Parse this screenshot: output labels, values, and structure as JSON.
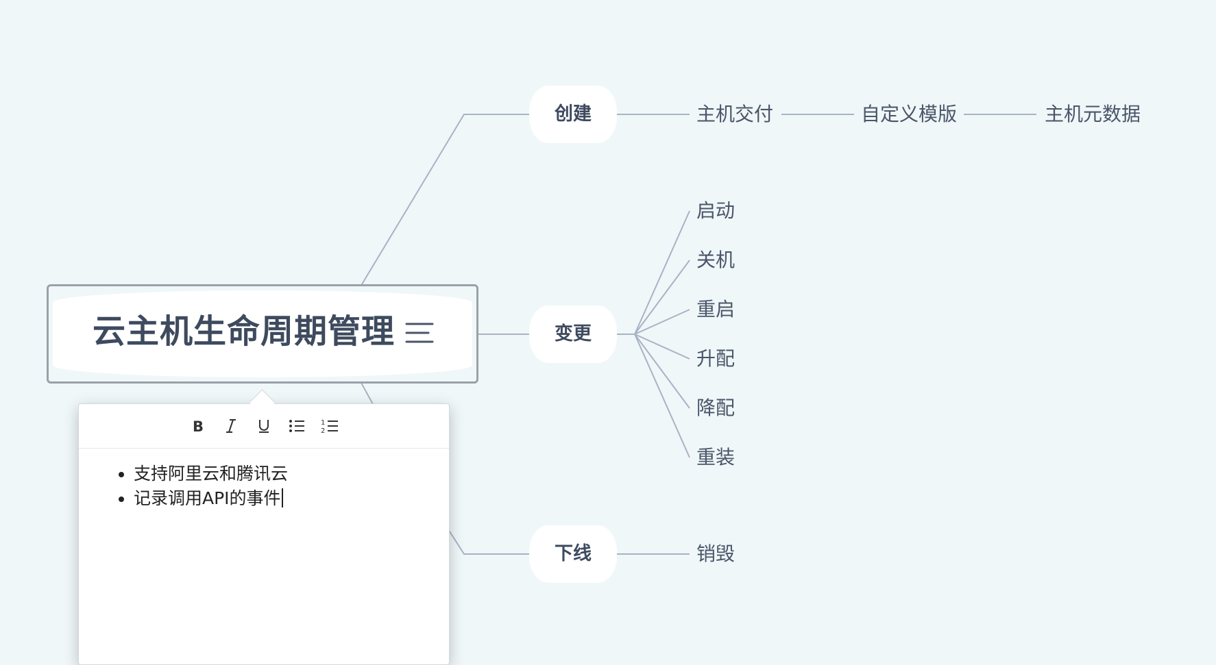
{
  "root": {
    "title": "云主机生命周期管理",
    "notes_icon": "notes-icon"
  },
  "branches": [
    {
      "label": "创建",
      "children": [
        "主机交付",
        "自定义模版",
        "主机元数据"
      ]
    },
    {
      "label": "变更",
      "children": [
        "启动",
        "关机",
        "重启",
        "升配",
        "降配",
        "重装"
      ]
    },
    {
      "label": "下线",
      "children": [
        "销毁"
      ]
    }
  ],
  "note_editor": {
    "toolbar": [
      {
        "name": "bold",
        "icon": "bold-icon"
      },
      {
        "name": "italic",
        "icon": "italic-icon"
      },
      {
        "name": "underline",
        "icon": "underline-icon"
      },
      {
        "name": "bulleted-list",
        "icon": "bulleted-list-icon"
      },
      {
        "name": "numbered-list",
        "icon": "numbered-list-icon"
      }
    ],
    "items": [
      "支持阿里云和腾讯云",
      "记录调用API的事件"
    ]
  },
  "colors": {
    "background": "#eff7f9",
    "connector": "#a8b3c4",
    "node_text": "#3e4a5e",
    "root_border": "#9aa1a8"
  }
}
